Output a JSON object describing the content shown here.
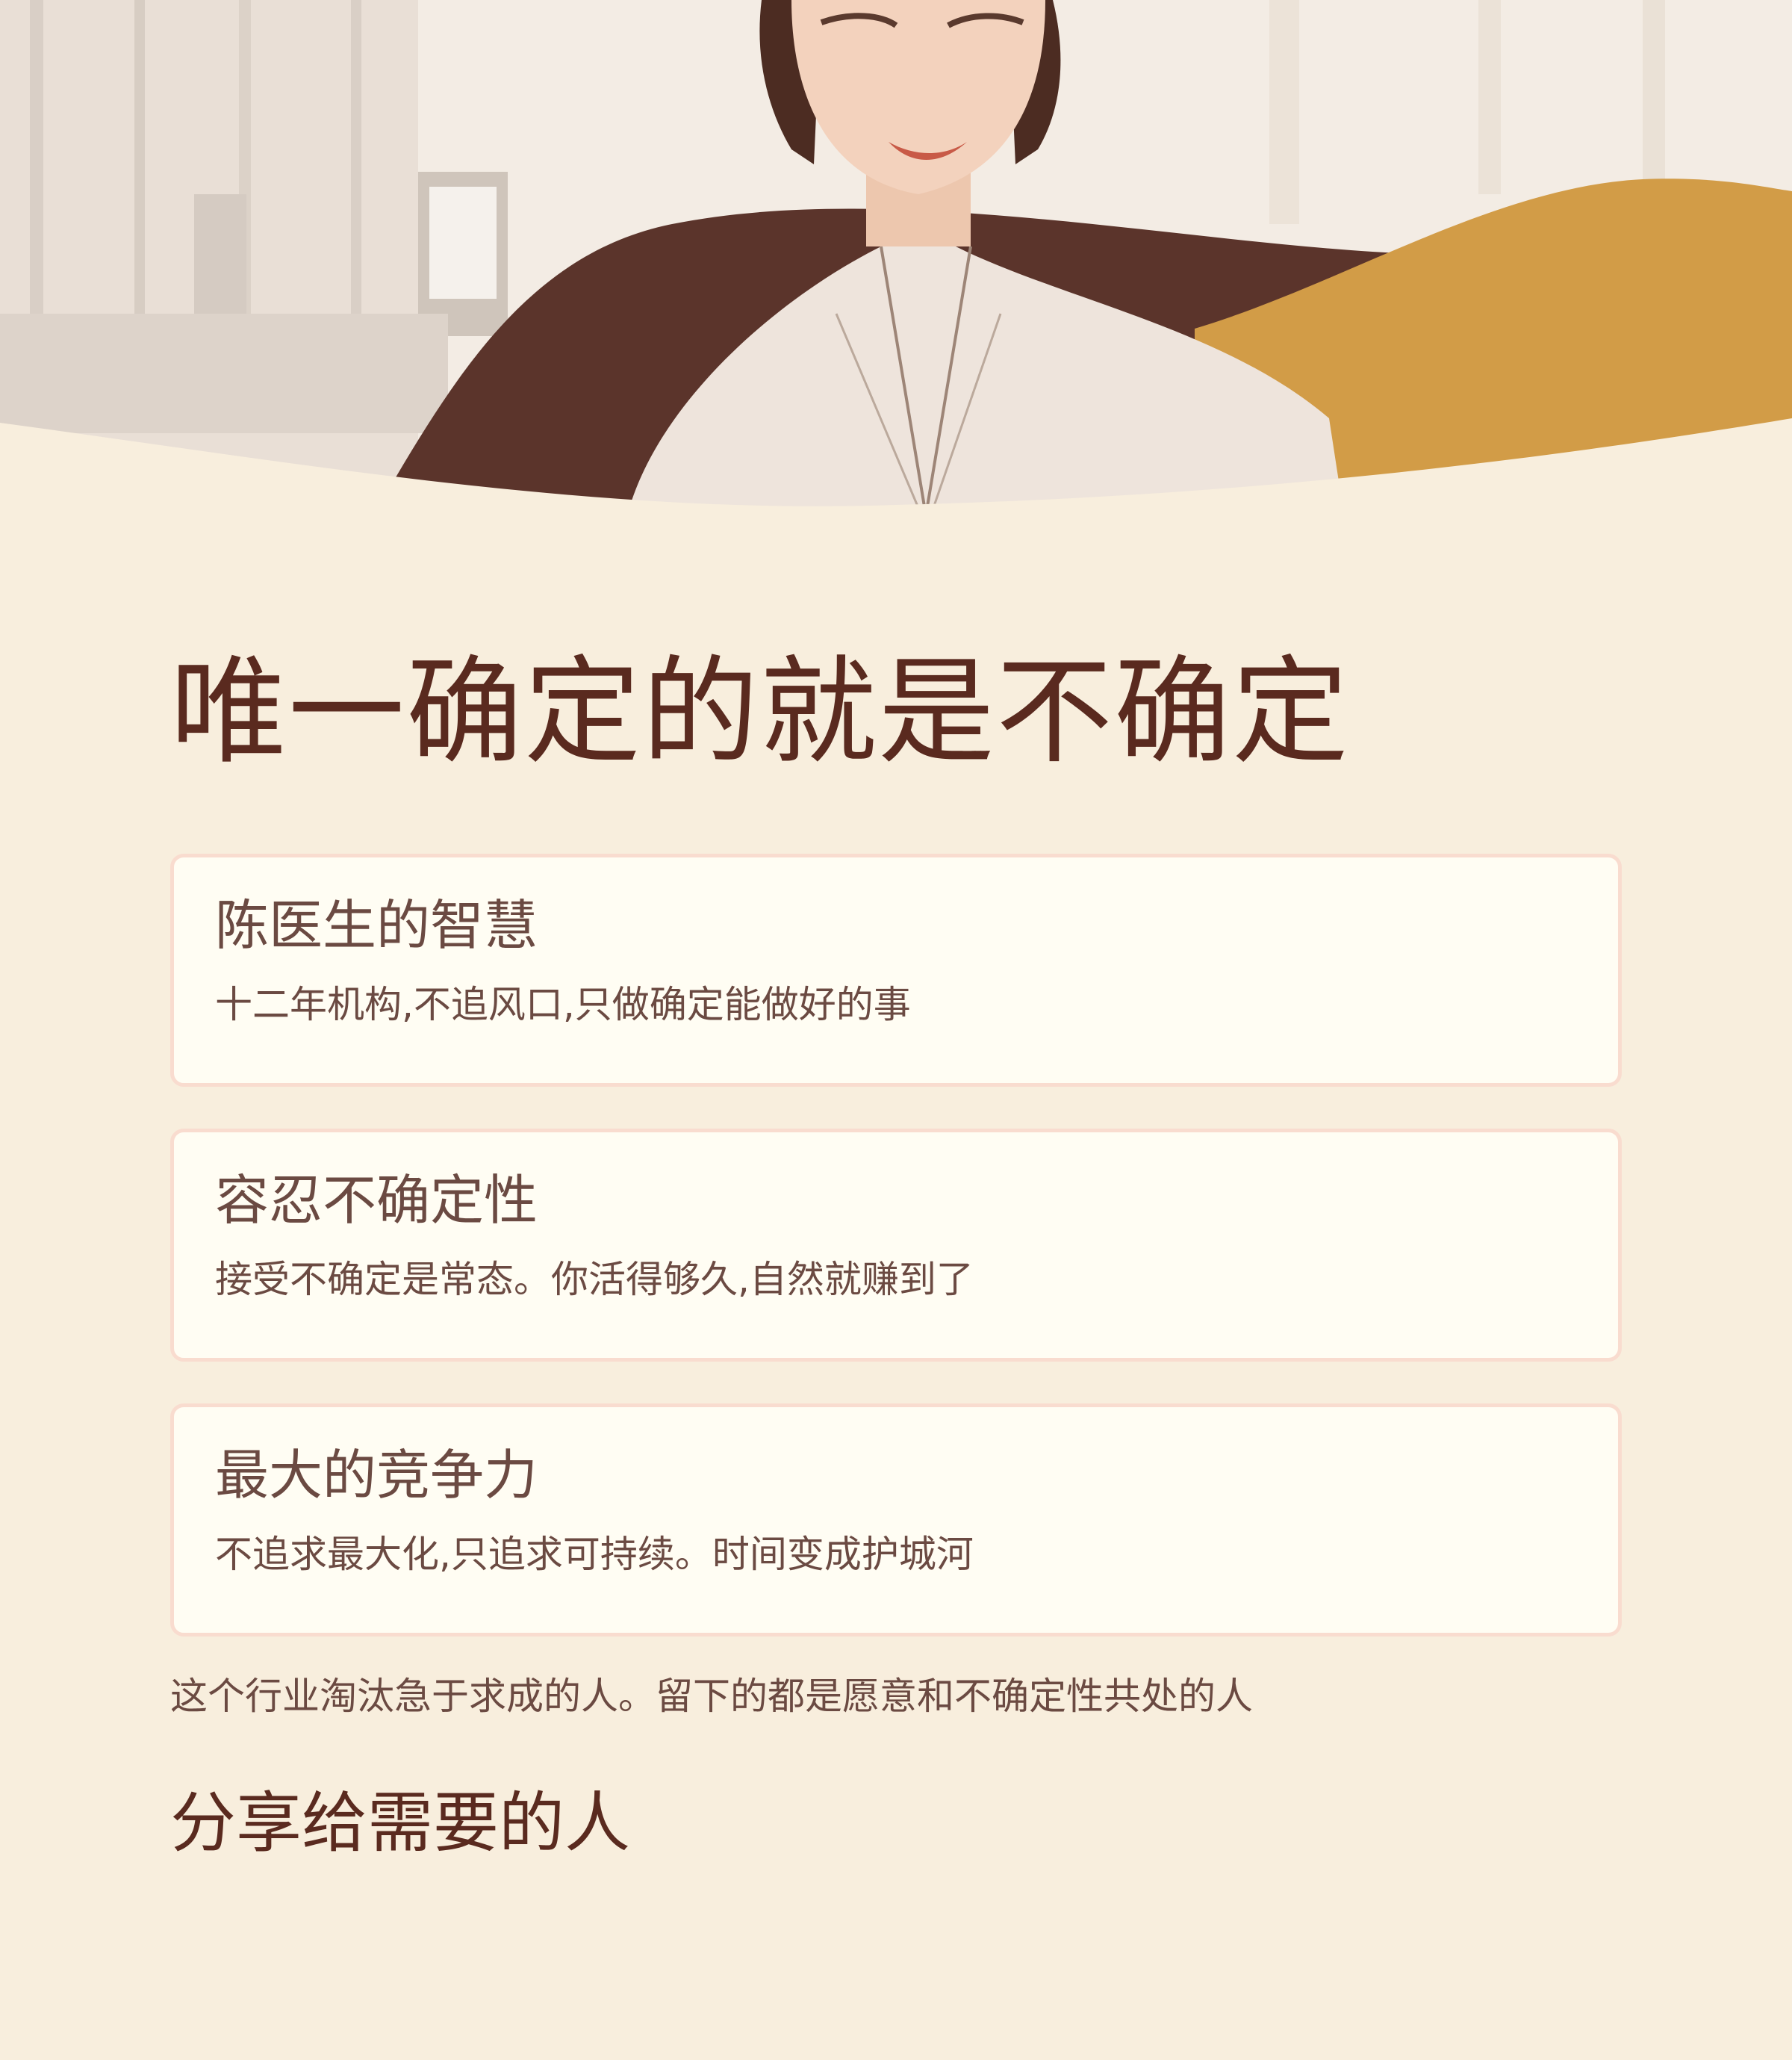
{
  "hero": {
    "illustration": "doctor-portrait-illustration"
  },
  "page": {
    "title": "唯一确定的就是不确定"
  },
  "cards": [
    {
      "title": "陈医生的智慧",
      "body": "十二年机构,不追风口,只做确定能做好的事"
    },
    {
      "title": "容忍不确定性",
      "body": "接受不确定是常态。你活得够久,自然就赚到了"
    },
    {
      "title": "最大的竞争力",
      "body": "不追求最大化,只追求可持续。时间变成护城河"
    }
  ],
  "footnote": "这个行业淘汰急于求成的人。留下的都是愿意和不确定性共处的人",
  "share": {
    "title": "分享给需要的人"
  },
  "colors": {
    "background": "#f8eedd",
    "title": "#5a2a1f",
    "text": "#6b4a42",
    "card_bg": "#fffdf3",
    "card_border": "#f9dccf",
    "wave_brown": "#5b342b",
    "wave_gold": "#d29c47"
  }
}
